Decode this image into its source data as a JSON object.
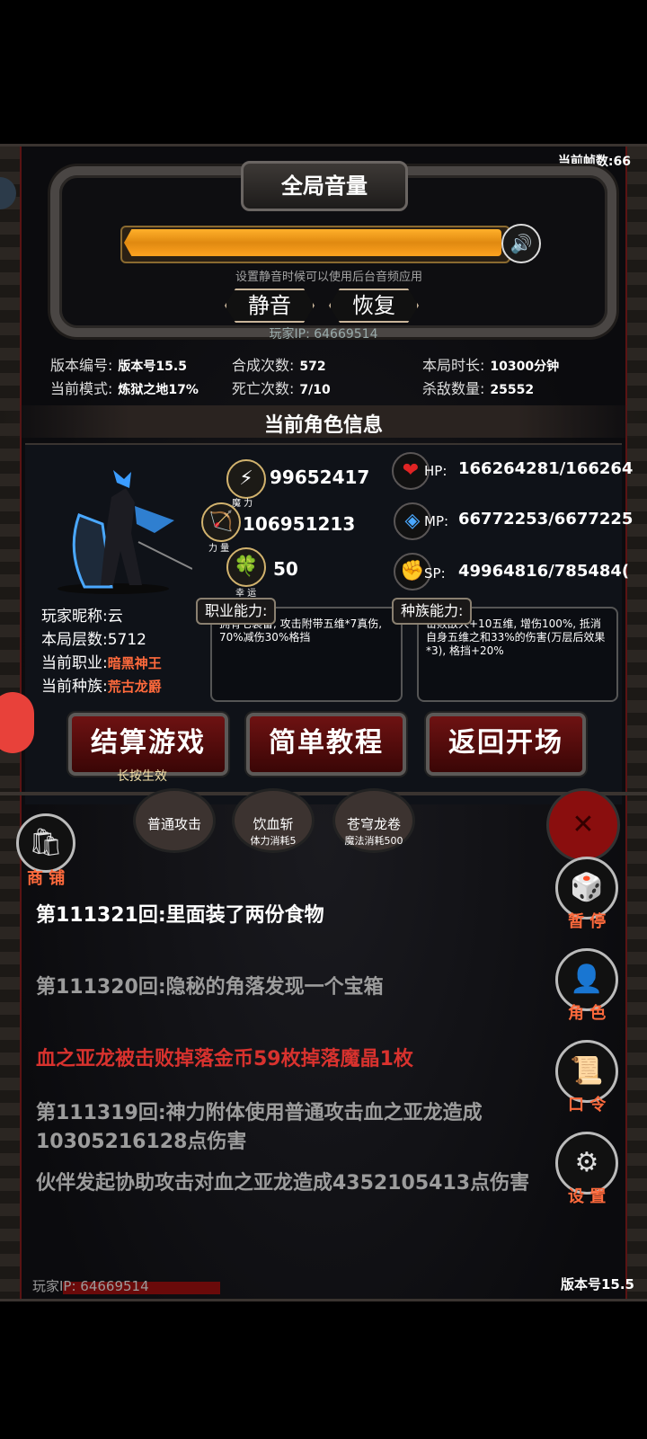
{
  "fps": "当前帧数:66",
  "volume": {
    "title": "全局音量",
    "level": 1.0,
    "hint": "设置静音时候可以使用后台音频应用",
    "mute_label": "静音",
    "restore_label": "恢复"
  },
  "player_ip": "玩家IP:  64669514",
  "stats": {
    "version_label": "版本编号:",
    "version_value": "版本号15.5",
    "mode_label": "当前模式:",
    "mode_value": "炼狱之地17%",
    "synth_label": "合成次数:",
    "synth_value": "572",
    "death_label": "死亡次数:",
    "death_value": "7/10",
    "duration_label": "本局时长:",
    "duration_value": "10300分钟",
    "kills_label": "杀敌数量:",
    "kills_value": "25552"
  },
  "character": {
    "section_title": "当前角色信息",
    "magic_value": "99652417",
    "magic_label": "魔 力",
    "power_value": "106951213",
    "power_label": "力 量",
    "luck_value": "50",
    "luck_label": "幸 运",
    "hp_label": "HP:",
    "hp_value": "166264281/166264",
    "mp_label": "MP:",
    "mp_value": "66772253/6677225",
    "sp_label": "SP:",
    "sp_value": "49964816/785484(",
    "nickname": "玩家昵称:云",
    "floor": "本局层数:5712",
    "job_label": "当前职业:",
    "job_value": "暗黑神王",
    "race_label": "当前种族:",
    "race_value": "荒古龙爵",
    "job_ability_tag": "职业能力:",
    "race_ability_tag": "种族能力:",
    "job_ability_text": "拥有七装备, 攻击附带五维*7真伤, 70%减伤30%格挡",
    "race_ability_text": "击败敌人+10五维, 增伤100%, 抵消自身五维之和33%的伤害(万层后效果*3), 格挡+20%"
  },
  "buttons": {
    "settle": "结算游戏",
    "settle_hint": "长按生效",
    "tutorial": "简单教程",
    "back": "返回开场"
  },
  "skills": [
    {
      "name": "普通攻击",
      "cost": ""
    },
    {
      "name": "饮血斩",
      "cost": "体力消耗5"
    },
    {
      "name": "苍穹龙卷",
      "cost": "魔法消耗500"
    }
  ],
  "shop_label": "商 铺",
  "side": {
    "pause": "暂 停",
    "role": "角 色",
    "code": "口 令",
    "settings": "设 置"
  },
  "log": [
    {
      "text": "第111321回:里面装了两份食物",
      "color": "#ffffff"
    },
    {
      "text": "第111320回:隐秘的角落发现一个宝箱",
      "color": "#9c9c9c"
    },
    {
      "text": "血之亚龙被击败掉落金币59枚掉落魔晶1枚",
      "color": "#d8322e"
    },
    {
      "text": "第111319回:神力附体使用普通攻击血之亚龙造成10305216128点伤害",
      "color": "#9c9c9c"
    },
    {
      "text": "伙伴发起协助攻击对血之亚龙造成4352105413点伤害",
      "color": "#9c9c9c"
    }
  ],
  "footer": {
    "player_ip": "玩家IP:  64669514",
    "version": "版本号15.5"
  },
  "colors": {
    "accent_red": "#ff6a3c",
    "volume_orange": "#e08910",
    "button_red": "#6e1212"
  }
}
